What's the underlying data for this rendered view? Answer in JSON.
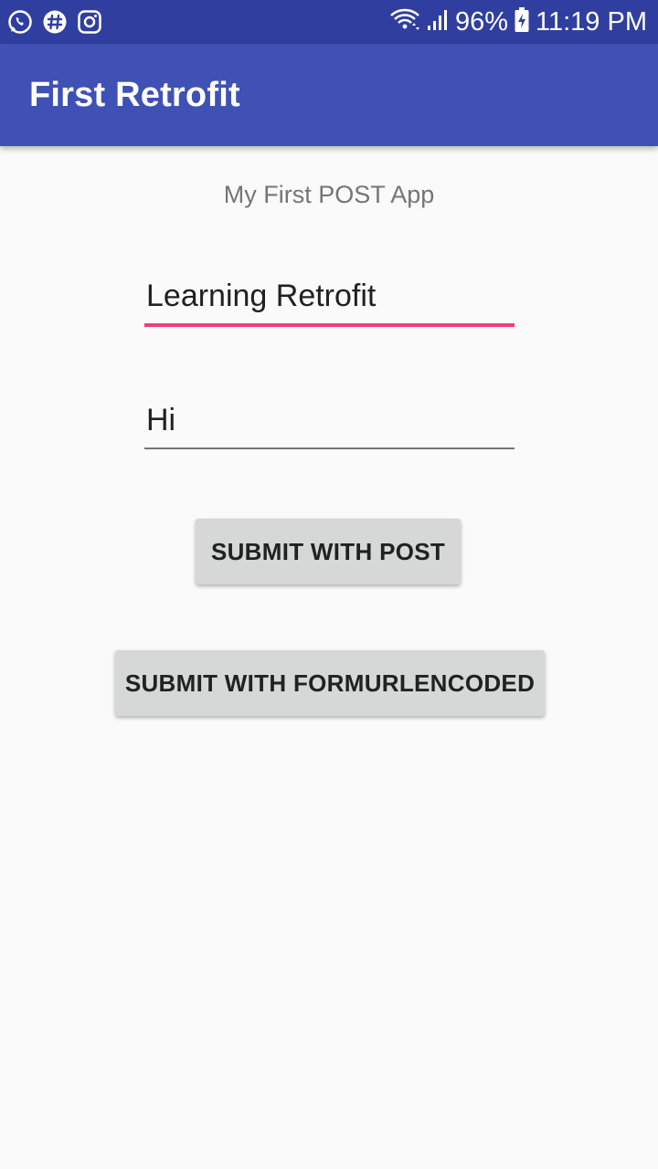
{
  "status_bar": {
    "notification_icons": [
      "whatsapp-icon",
      "slack-icon",
      "instagram-icon"
    ],
    "battery_percent": "96%",
    "time": "11:19 PM",
    "background_color": "#303f9f"
  },
  "app_bar": {
    "title": "First Retrofit",
    "background_color": "#3f51b5"
  },
  "main": {
    "subtitle": "My First POST App",
    "title_field": {
      "value": "Learning Retrofit",
      "focused": true,
      "accent_color": "#e91e63"
    },
    "body_field": {
      "value": "Hi"
    },
    "submit_post_label": "SUBMIT WITH POST",
    "submit_form_label": "SUBMIT WITH FORMURLENCODED"
  }
}
